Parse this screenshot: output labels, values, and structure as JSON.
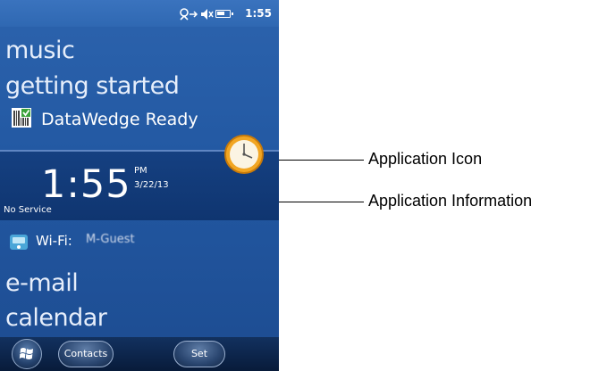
{
  "status_bar": {
    "time": "1:55",
    "icons": [
      "connectivity-icon",
      "speaker-muted-icon",
      "battery-icon"
    ]
  },
  "home_items": {
    "music": "music",
    "getting_started": "getting started",
    "datawedge": "DataWedge Ready",
    "email": "e-mail",
    "calendar": "calendar"
  },
  "time_panel": {
    "time": "1:55",
    "ampm": "PM",
    "date": "3/22/13",
    "carrier": "No Service"
  },
  "wifi": {
    "label": "Wi-Fi:",
    "ssid": "M-Guest"
  },
  "soft_keys": {
    "left": "Contacts",
    "right": "Set"
  },
  "callouts": {
    "icon": "Application Icon",
    "info": "Application Information"
  },
  "colors": {
    "screen_bg": "#2258a2",
    "time_band": "#154081",
    "bottom_bar": "#0c2246"
  }
}
